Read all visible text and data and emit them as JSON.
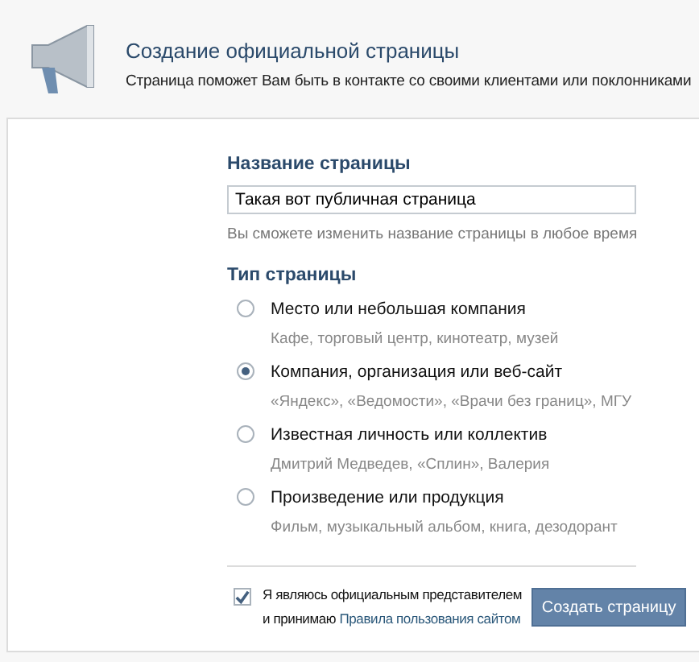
{
  "header": {
    "title": "Создание официальной страницы",
    "subtitle": "Страница поможет Вам быть в контакте со своими клиентами или поклонниками"
  },
  "name_section": {
    "heading": "Название страницы",
    "value": "Такая вот публичная страница",
    "hint": "Вы сможете изменить название страницы в любое время"
  },
  "type_section": {
    "heading": "Тип страницы",
    "options": [
      {
        "label": "Место или небольшая компания",
        "examples": "Кафе, торговый центр, кинотеатр, музей",
        "selected": false
      },
      {
        "label": "Компания, организация или веб-сайт",
        "examples": "«Яндекс», «Ведомости», «Врачи без границ», МГУ",
        "selected": true
      },
      {
        "label": "Известная личность или коллектив",
        "examples": "Дмитрий Медведев, «Сплин», Валерия",
        "selected": false
      },
      {
        "label": "Произведение или продукция",
        "examples": "Фильм, музыкальный альбом, книга, дезодорант",
        "selected": false
      }
    ]
  },
  "agreement": {
    "checked": true,
    "line_1": "Я являюсь официальным представителем",
    "line_2": "и принимаю",
    "link": "Правила пользования сайтом"
  },
  "submit_button": "Создать страницу"
}
